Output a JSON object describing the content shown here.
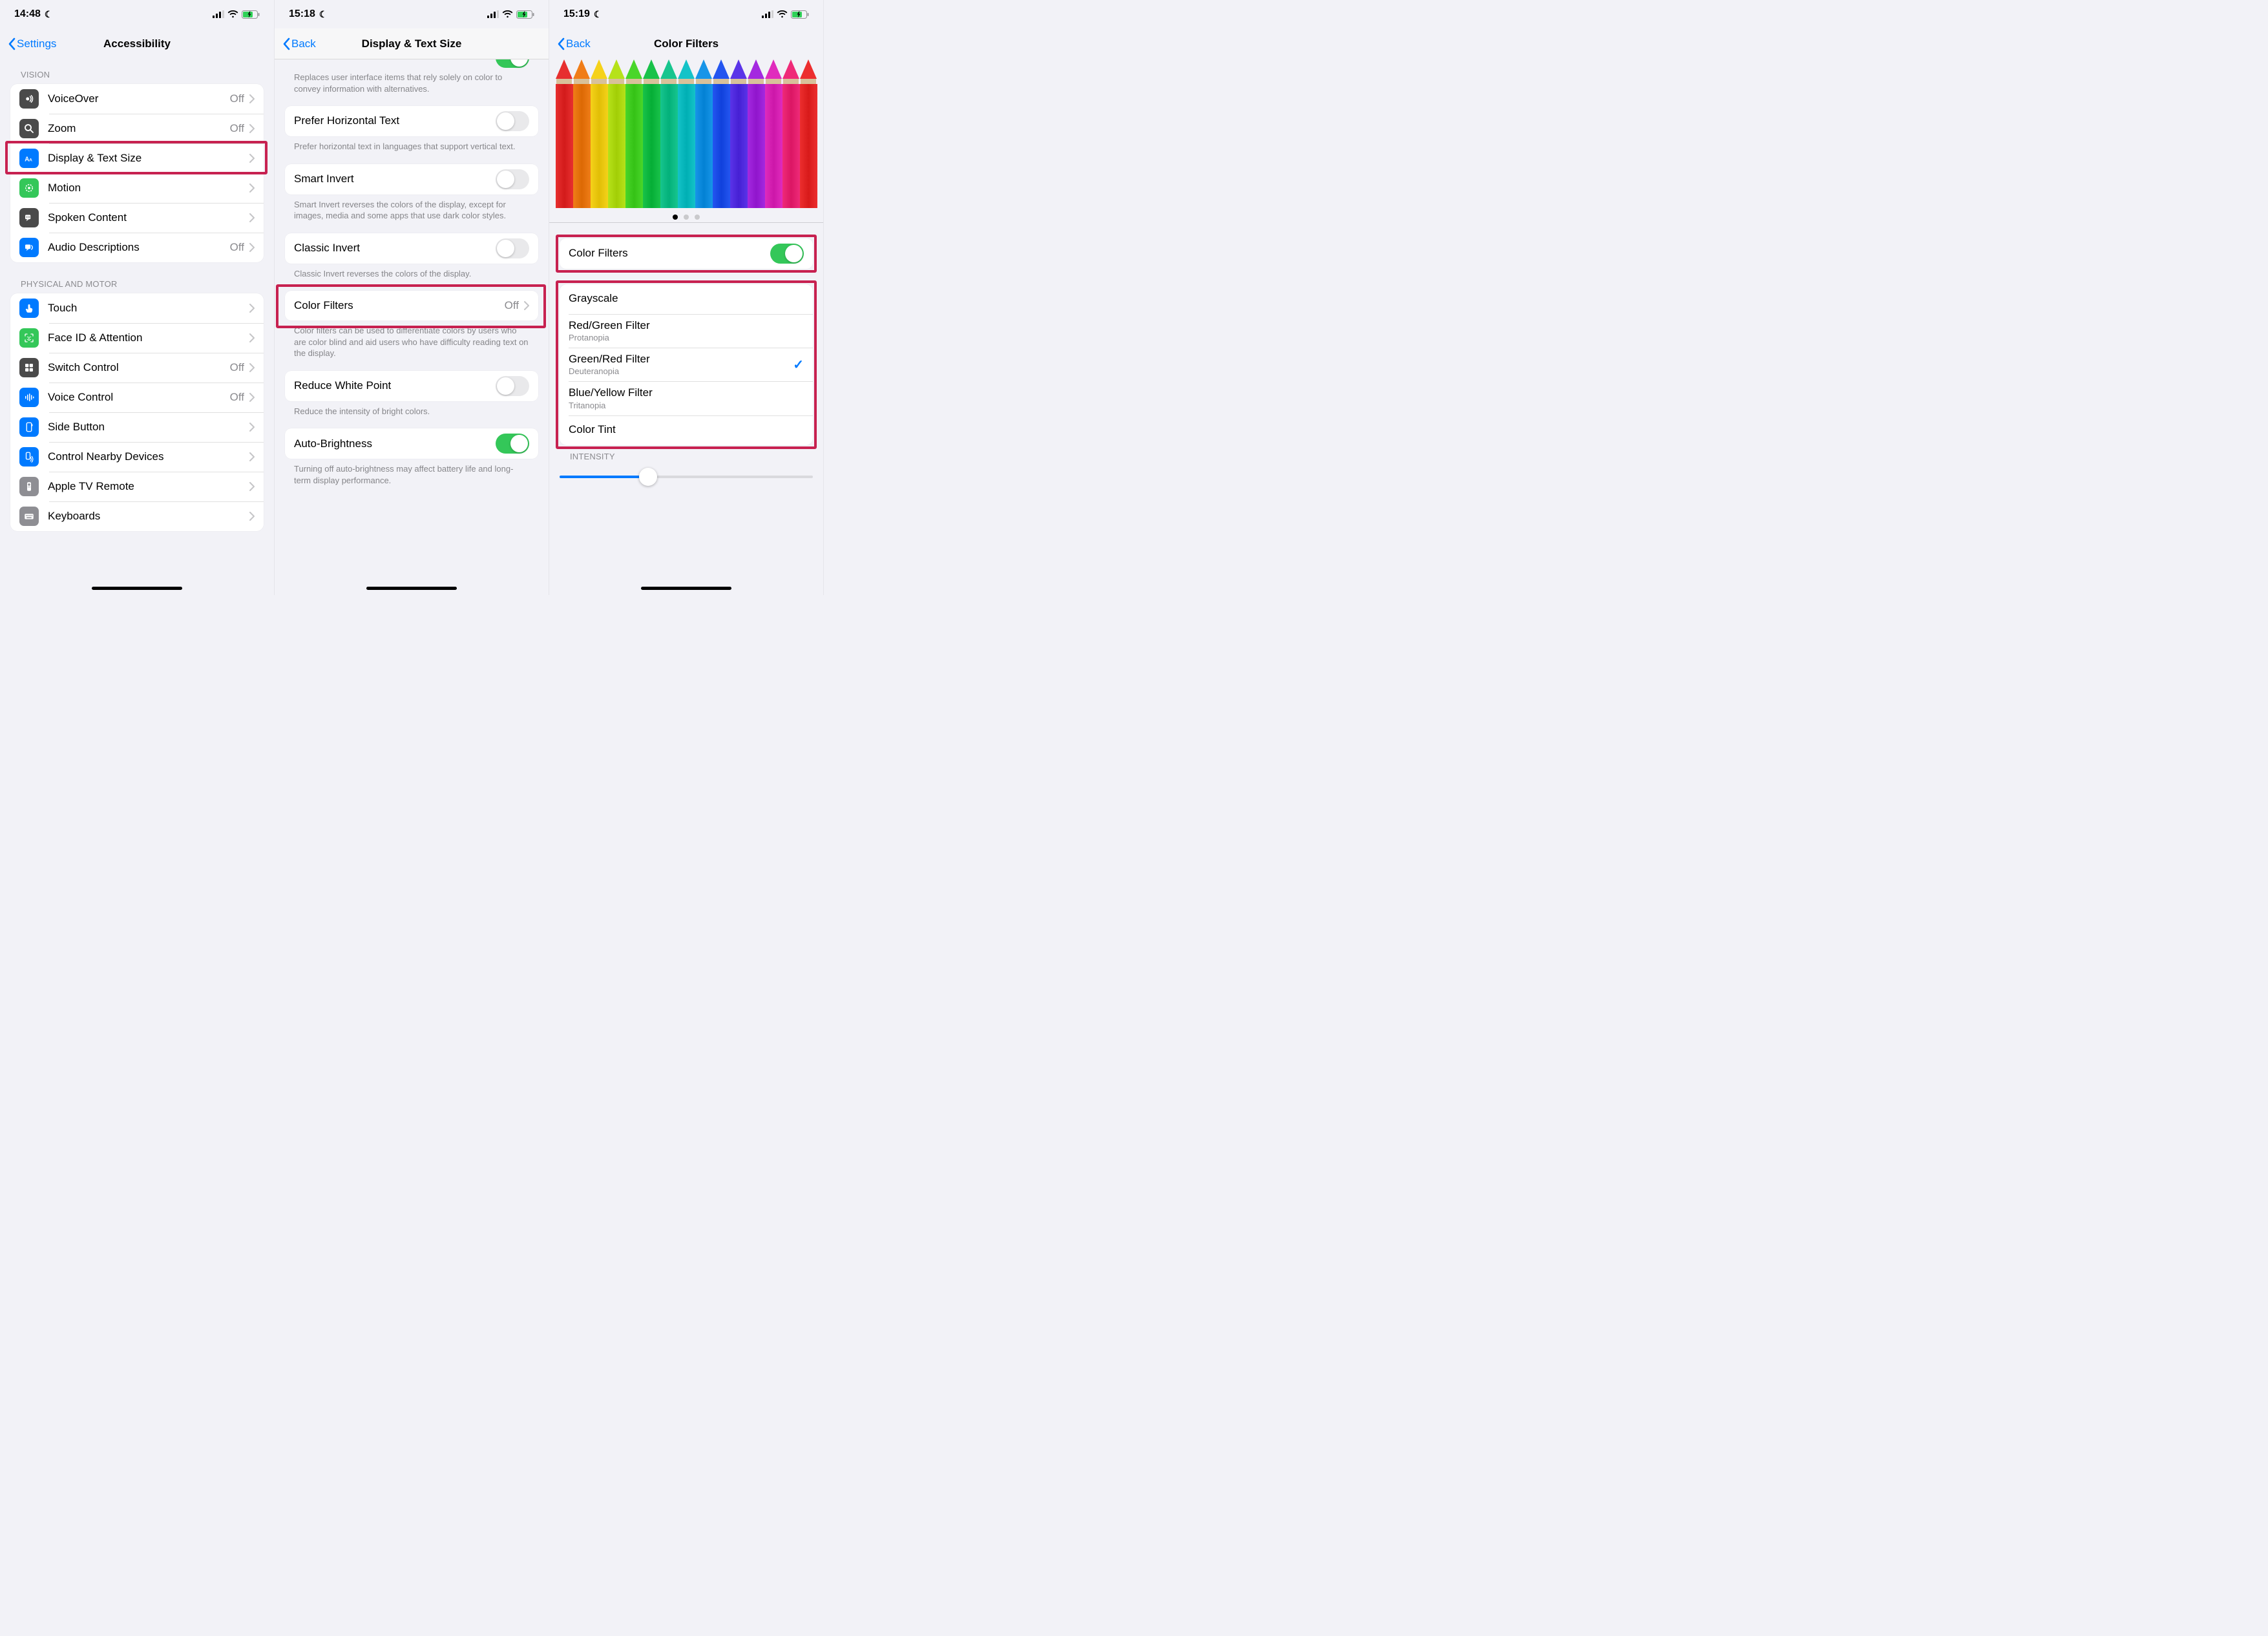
{
  "screens": [
    {
      "status": {
        "time": "14:48"
      },
      "nav": {
        "back": "Settings",
        "title": "Accessibility"
      },
      "sections": [
        {
          "header": "VISION",
          "items": [
            {
              "icon": "voiceover",
              "color": "#4a4a4a",
              "label": "VoiceOver",
              "value": "Off",
              "nav": true
            },
            {
              "icon": "zoom",
              "color": "#4a4a4a",
              "label": "Zoom",
              "value": "Off",
              "nav": true
            },
            {
              "icon": "textsize",
              "color": "#007aff",
              "label": "Display & Text Size",
              "nav": true,
              "highlight": true
            },
            {
              "icon": "motion",
              "color": "#34c759",
              "label": "Motion",
              "nav": true
            },
            {
              "icon": "spoken",
              "color": "#4a4a4a",
              "label": "Spoken Content",
              "nav": true
            },
            {
              "icon": "audio",
              "color": "#007aff",
              "label": "Audio Descriptions",
              "value": "Off",
              "nav": true
            }
          ]
        },
        {
          "header": "PHYSICAL AND MOTOR",
          "items": [
            {
              "icon": "touch",
              "color": "#007aff",
              "label": "Touch",
              "nav": true
            },
            {
              "icon": "faceid",
              "color": "#34c759",
              "label": "Face ID & Attention",
              "nav": true
            },
            {
              "icon": "switch",
              "color": "#4a4a4a",
              "label": "Switch Control",
              "value": "Off",
              "nav": true
            },
            {
              "icon": "voicectrl",
              "color": "#007aff",
              "label": "Voice Control",
              "value": "Off",
              "nav": true
            },
            {
              "icon": "sidebtn",
              "color": "#007aff",
              "label": "Side Button",
              "nav": true
            },
            {
              "icon": "nearby",
              "color": "#007aff",
              "label": "Control Nearby Devices",
              "nav": true
            },
            {
              "icon": "tvremote",
              "color": "#8e8e93",
              "label": "Apple TV Remote",
              "nav": true
            },
            {
              "icon": "keyboards",
              "color": "#8e8e93",
              "label": "Keyboards",
              "nav": true
            }
          ]
        }
      ]
    },
    {
      "status": {
        "time": "15:18"
      },
      "nav": {
        "back": "Back",
        "title": "Display & Text Size"
      },
      "items": [
        {
          "type": "note",
          "text": "Replaces user interface items that rely solely on color to convey information with alternatives."
        },
        {
          "type": "switch",
          "label": "Prefer Horizontal Text",
          "on": false,
          "note": "Prefer horizontal text in languages that support vertical text."
        },
        {
          "type": "switch",
          "label": "Smart Invert",
          "on": false,
          "note": "Smart Invert reverses the colors of the display, except for images, media and some apps that use dark color styles."
        },
        {
          "type": "switch",
          "label": "Classic Invert",
          "on": false,
          "note": "Classic Invert reverses the colors of the display."
        },
        {
          "type": "nav",
          "label": "Color Filters",
          "value": "Off",
          "highlight": true,
          "note": "Color filters can be used to differentiate colors by users who are color blind and aid users who have difficulty reading text on the display."
        },
        {
          "type": "switch",
          "label": "Reduce White Point",
          "on": false,
          "note": "Reduce the intensity of bright colors."
        },
        {
          "type": "switch",
          "label": "Auto-Brightness",
          "on": true,
          "note": "Turning off auto-brightness may affect battery life and long-term display performance."
        }
      ]
    },
    {
      "status": {
        "time": "15:19"
      },
      "nav": {
        "back": "Back",
        "title": "Color Filters"
      },
      "pencils": [
        "#e72f2f",
        "#f07d18",
        "#f5d21a",
        "#b6e21a",
        "#49d62a",
        "#19c24a",
        "#17c58e",
        "#14c3c8",
        "#1795e8",
        "#2455f0",
        "#5a34e8",
        "#a429e0",
        "#e02bbd",
        "#ef2a78",
        "#ec2e2e"
      ],
      "toggle": {
        "label": "Color Filters",
        "on": true,
        "highlight": true
      },
      "filters": {
        "highlight": true,
        "options": [
          {
            "label": "Grayscale"
          },
          {
            "label": "Red/Green Filter",
            "sub": "Protanopia"
          },
          {
            "label": "Green/Red Filter",
            "sub": "Deuteranopia",
            "selected": true
          },
          {
            "label": "Blue/Yellow Filter",
            "sub": "Tritanopia"
          },
          {
            "label": "Color Tint"
          }
        ]
      },
      "intensity": {
        "header": "INTENSITY",
        "value": 0.35
      }
    }
  ]
}
